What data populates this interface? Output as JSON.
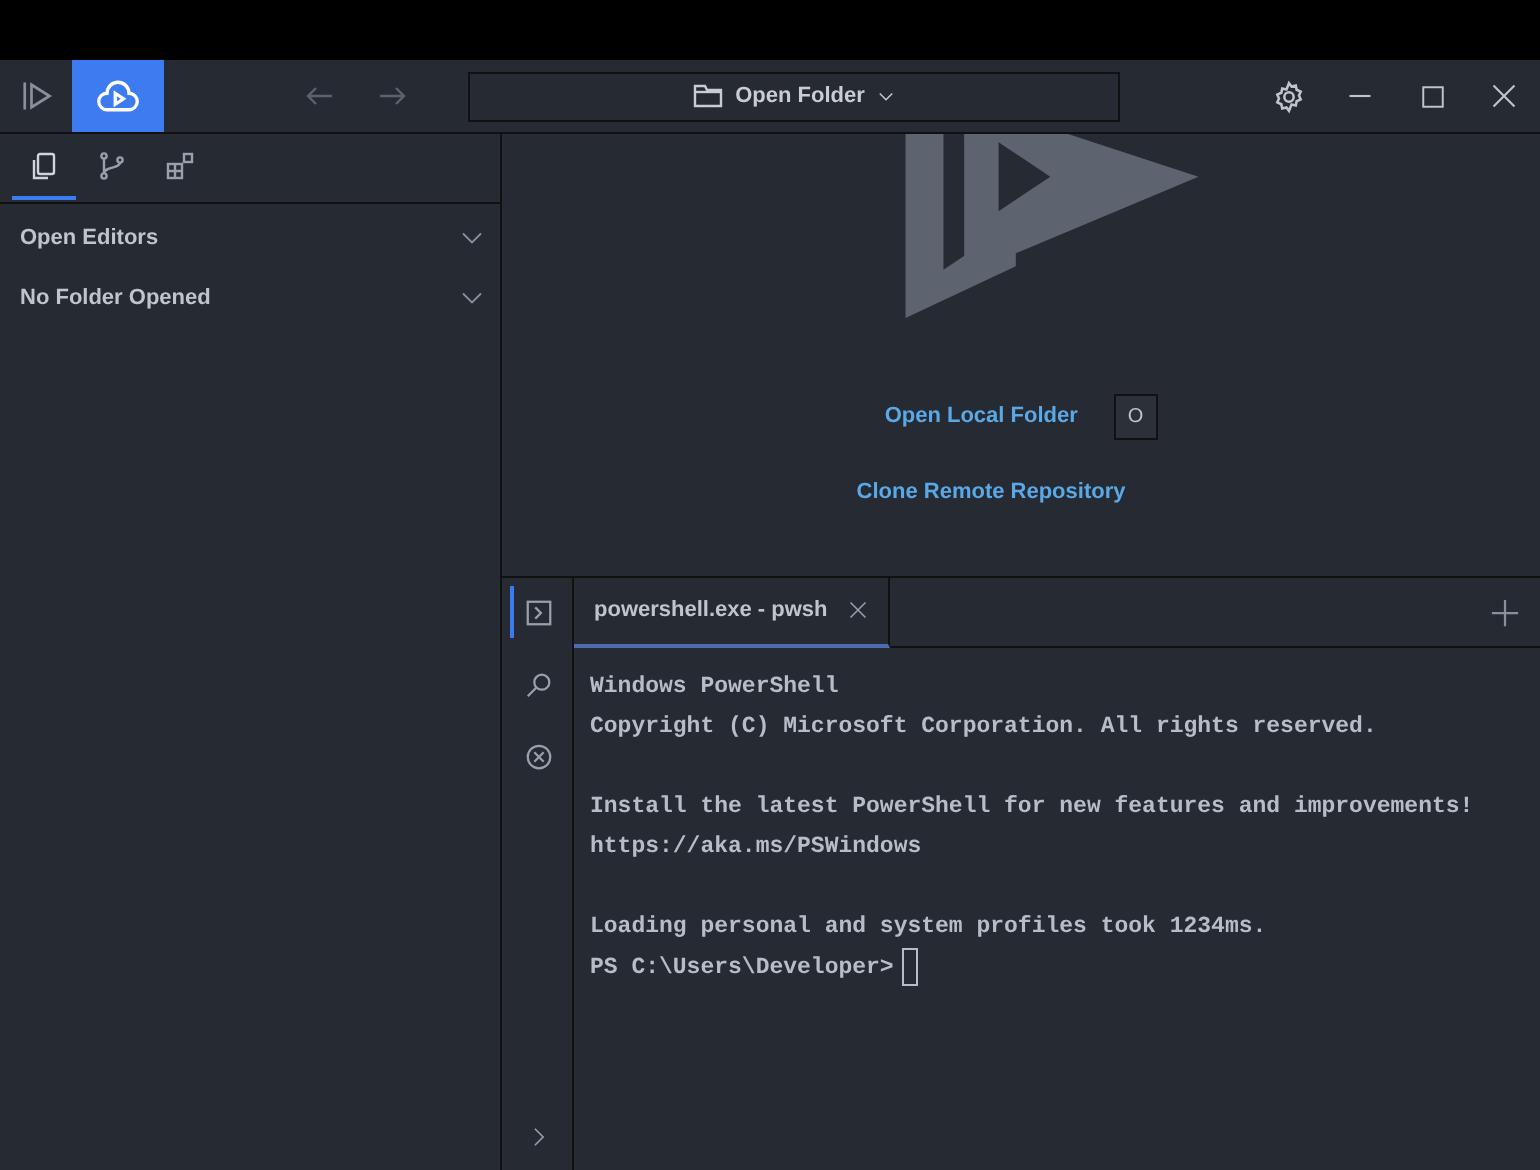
{
  "toolbar": {
    "cloud_selected": true,
    "folder_title": "Open Folder"
  },
  "sidebar": {
    "tabs": [
      {
        "kind": "files",
        "selected": true
      },
      {
        "kind": "git",
        "selected": false
      },
      {
        "kind": "extensions",
        "selected": false
      }
    ],
    "sections": [
      {
        "title": "Open Editors",
        "expanded": false
      },
      {
        "title": "No Folder Opened",
        "expanded": false
      }
    ]
  },
  "welcome": {
    "links": [
      {
        "label": "Open Local Folder",
        "shortcut": "O"
      },
      {
        "label": "Clone Remote Repository"
      }
    ]
  },
  "terminal": {
    "side_tabs": [
      {
        "kind": "terminal",
        "selected": true
      },
      {
        "kind": "search",
        "selected": false
      },
      {
        "kind": "problems",
        "selected": false
      }
    ],
    "tabs": [
      {
        "label": "powershell.exe - pwsh",
        "selected": true
      }
    ],
    "paragraphs": [
      [
        "Windows PowerShell",
        "Copyright (C) Microsoft Corporation. All rights reserved."
      ],
      [
        "Install the latest PowerShell for new features and improvements! https://aka.ms/PSWindows"
      ],
      [
        "Loading personal and system profiles took 1234ms.",
        "PS C:\\Users\\Developer>"
      ]
    ]
  }
}
